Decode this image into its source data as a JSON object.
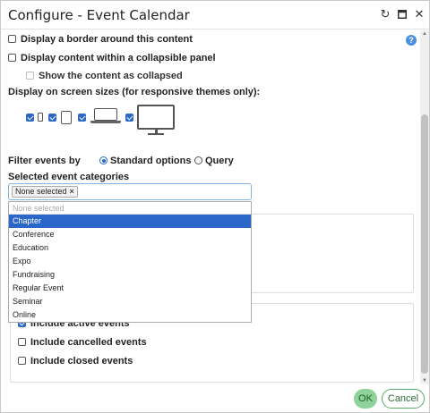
{
  "window": {
    "title": "Configure - Event Calendar",
    "icons": [
      "refresh-icon",
      "maximize-icon",
      "close-icon"
    ]
  },
  "options": {
    "border_label": "Display a border around this content",
    "collapsible_label": "Display content within a collapsible panel",
    "collapsed_label": "Show the content as collapsed",
    "screen_sizes_label": "Display on screen sizes (for responsive themes only):",
    "devices": [
      {
        "icon": "phone-icon",
        "checked": true
      },
      {
        "icon": "tablet-icon",
        "checked": true
      },
      {
        "icon": "laptop-icon",
        "checked": true
      },
      {
        "icon": "desktop-icon",
        "checked": true
      }
    ]
  },
  "filter": {
    "label": "Filter events by",
    "standard_label": "Standard options",
    "query_label": "Query",
    "selected": "Standard options"
  },
  "categories": {
    "label": "Selected event categories",
    "tag": "None selected",
    "tag_remove": "×",
    "placeholder": "None selected",
    "items": [
      "Chapter",
      "Conference",
      "Education",
      "Expo",
      "Fundraising",
      "Regular Event",
      "Seminar",
      "Online"
    ],
    "highlighted": "Chapter"
  },
  "include": {
    "active_label": "Include active events",
    "active_checked": true,
    "cancelled_label": "Include cancelled events",
    "cancelled_checked": false,
    "closed_label": "Include closed events",
    "closed_checked": false
  },
  "footer": {
    "ok_label": "OK",
    "cancel_label": "Cancel"
  },
  "colors": {
    "accent": "#2a67c9",
    "ok_bg": "#8fd29b",
    "cancel_border": "#5aaa6a"
  }
}
